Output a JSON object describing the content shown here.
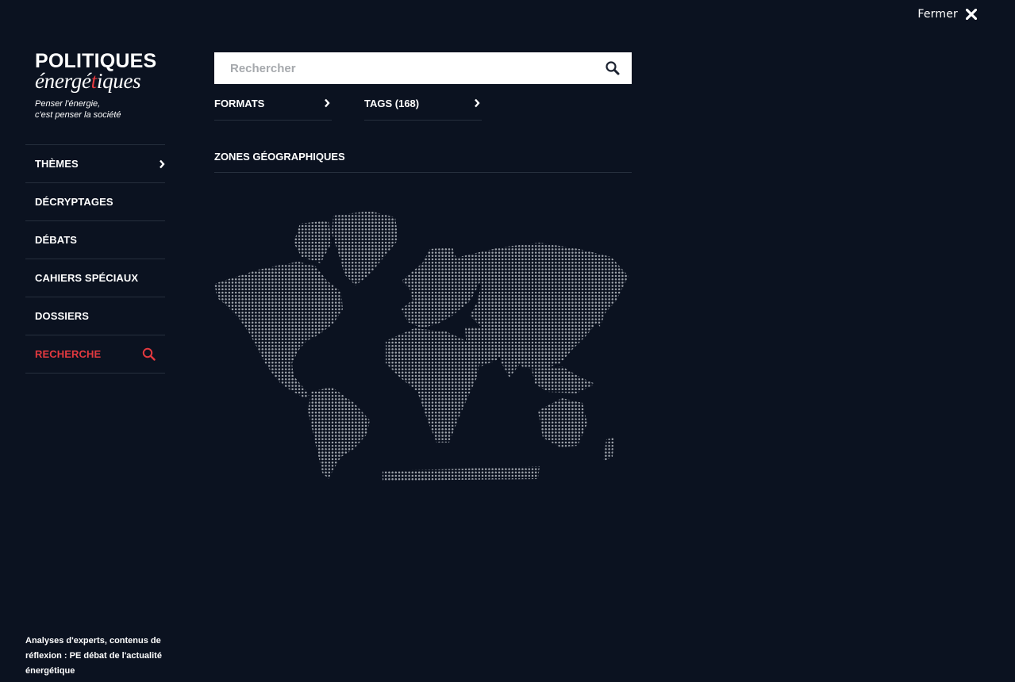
{
  "header": {
    "close_label": "Fermer"
  },
  "logo": {
    "line1": "POLITIQUES",
    "line2_before": "énergé",
    "line2_accent": "t",
    "line2_after": "iques",
    "tagline_line1": "Penser l'énergie,",
    "tagline_line2": "c'est penser la société"
  },
  "nav": {
    "items": [
      {
        "label": "THÈMES",
        "has_chevron": true
      },
      {
        "label": "DÉCRYPTAGES"
      },
      {
        "label": "DÉBATS"
      },
      {
        "label": "CAHIERS SPÉCIAUX"
      },
      {
        "label": "DOSSIERS"
      },
      {
        "label": "RECHERCHE",
        "active": true,
        "icon": "search-icon"
      }
    ]
  },
  "search": {
    "placeholder": "Rechercher",
    "value": ""
  },
  "filters": {
    "formats_label": "FORMATS",
    "tags_label": "TAGS (168)"
  },
  "zones": {
    "title": "ZONES GÉOGRAPHIQUES"
  },
  "footer": {
    "text": "Analyses d'experts, contenus de réflexion : PE débat de l'actualité énergétique"
  },
  "colors": {
    "background": "#0b1220",
    "accent": "#e3393f",
    "divider": "#262f3d",
    "map_dot": "#9ea3ab"
  }
}
